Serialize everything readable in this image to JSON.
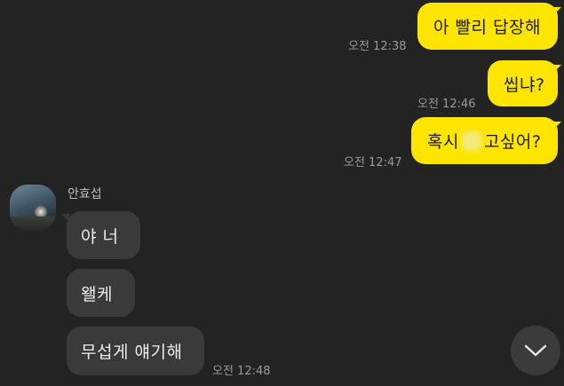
{
  "messages": {
    "m1": {
      "text": "아 빨리 답장해",
      "time": "오전 12:38"
    },
    "m2": {
      "text": "씹냐?",
      "time": "오전 12:46"
    },
    "m3": {
      "text_before": "혹시",
      "text_after": "고싶어?",
      "time": "오전 12:47"
    },
    "sender_name": "안효섭",
    "r1": {
      "text": "야 너"
    },
    "r2": {
      "text": "왤케"
    },
    "r3": {
      "text": "무섭게 얘기해",
      "time": "오전 12:48"
    }
  },
  "icons": {
    "scroll_down": "chevron-down-icon"
  },
  "colors": {
    "background": "#232323",
    "my_bubble": "#fee500",
    "their_bubble": "#3a3a3a"
  }
}
